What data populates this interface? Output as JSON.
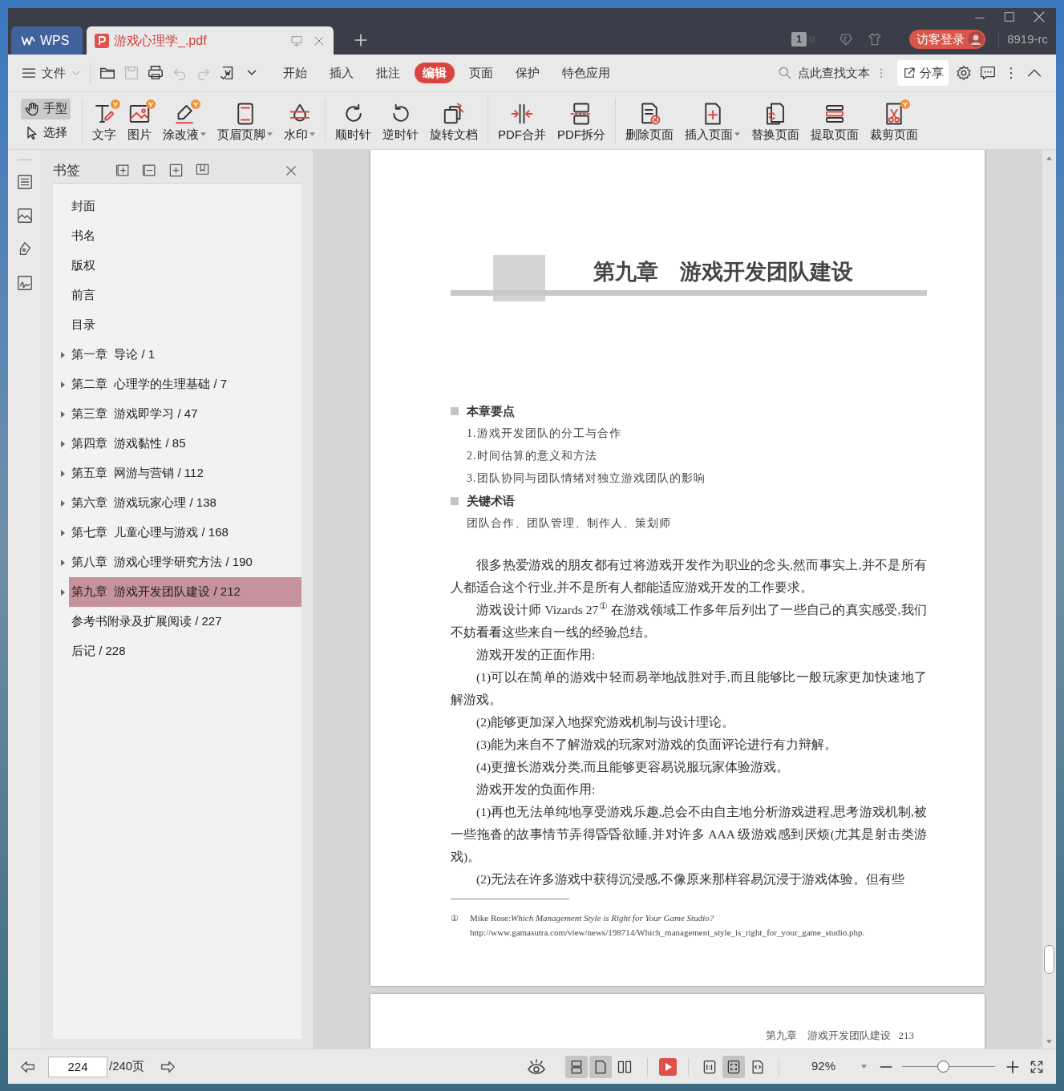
{
  "tabs": [
    {
      "kind": "home",
      "label": "WPS",
      "selected": false
    },
    {
      "kind": "file",
      "label": "游戏心理学_.pdf",
      "selected": true
    }
  ],
  "title_bar": {
    "window_count": "1",
    "login_button": "访客登录",
    "account": "8919-rc"
  },
  "menu_bar": {
    "file_menu": "文件",
    "tabs": [
      {
        "label": "开始",
        "selected": false
      },
      {
        "label": "插入",
        "selected": false
      },
      {
        "label": "批注",
        "selected": false
      },
      {
        "label": "编辑",
        "selected": true
      },
      {
        "label": "页面",
        "selected": false
      },
      {
        "label": "保护",
        "selected": false
      },
      {
        "label": "特色应用",
        "selected": false
      }
    ],
    "search": {
      "placeholder": "点此查找文本"
    },
    "share_button": "分享"
  },
  "toolbar": {
    "modes": [
      {
        "label": "手型",
        "kind": "hand",
        "selected": true
      },
      {
        "label": "选择",
        "kind": "pointer",
        "selected": false
      }
    ],
    "groups": [
      [
        {
          "label": "文字",
          "kind": "text",
          "badge": true,
          "dropdown": false
        },
        {
          "label": "图片",
          "kind": "image",
          "badge": true,
          "dropdown": false
        },
        {
          "label": "涂改液",
          "kind": "pen",
          "badge": true,
          "dropdown": true
        },
        {
          "label": "页眉页脚",
          "kind": "header",
          "badge": false,
          "dropdown": true
        },
        {
          "label": "水印",
          "kind": "watermark",
          "badge": false,
          "dropdown": true
        }
      ],
      [
        {
          "label": "顺时针",
          "kind": "rotate-cw",
          "badge": false,
          "dropdown": false
        },
        {
          "label": "逆时针",
          "kind": "rotate-ccw",
          "badge": false,
          "dropdown": false
        },
        {
          "label": "旋转文档",
          "kind": "rotate-doc",
          "badge": false,
          "dropdown": false
        }
      ],
      [
        {
          "label": "PDF合并",
          "kind": "merge",
          "badge": false,
          "dropdown": false
        },
        {
          "label": "PDF拆分",
          "kind": "split",
          "badge": false,
          "dropdown": false
        }
      ],
      [
        {
          "label": "删除页面",
          "kind": "delete-page",
          "badge": false,
          "dropdown": false
        },
        {
          "label": "插入页面",
          "kind": "insert-page",
          "badge": false,
          "dropdown": true
        },
        {
          "label": "替换页面",
          "kind": "replace-page",
          "badge": false,
          "dropdown": false
        },
        {
          "label": "提取页面",
          "kind": "extract-page",
          "badge": false,
          "dropdown": false
        },
        {
          "label": "裁剪页面",
          "kind": "crop-page",
          "badge": true,
          "dropdown": false
        }
      ]
    ]
  },
  "sidebar": {
    "title": "书签",
    "bookmarks": [
      {
        "label": "封面",
        "expandable": false,
        "selected": false
      },
      {
        "label": "书名",
        "expandable": false,
        "selected": false
      },
      {
        "label": "版权",
        "expandable": false,
        "selected": false
      },
      {
        "label": "前言",
        "expandable": false,
        "selected": false
      },
      {
        "label": "目录",
        "expandable": false,
        "selected": false
      },
      {
        "label": "第一章  导论 / 1",
        "expandable": true,
        "selected": false
      },
      {
        "label": "第二章  心理学的生理基础 / 7",
        "expandable": true,
        "selected": false
      },
      {
        "label": "第三章  游戏即学习 / 47",
        "expandable": true,
        "selected": false
      },
      {
        "label": "第四章  游戏黏性 / 85",
        "expandable": true,
        "selected": false
      },
      {
        "label": "第五章  网游与营销 / 112",
        "expandable": true,
        "selected": false
      },
      {
        "label": "第六章  游戏玩家心理 / 138",
        "expandable": true,
        "selected": false
      },
      {
        "label": "第七章  儿童心理与游戏 / 168",
        "expandable": true,
        "selected": false
      },
      {
        "label": "第八章  游戏心理学研究方法 / 190",
        "expandable": true,
        "selected": false
      },
      {
        "label": "第九章  游戏开发团队建设 / 212",
        "expandable": true,
        "selected": true
      },
      {
        "label": "参考书附录及扩展阅读 / 227",
        "expandable": false,
        "selected": false
      },
      {
        "label": "后记 / 228",
        "expandable": false,
        "selected": false
      }
    ]
  },
  "page": {
    "chapter_title": "第九章　游戏开发团队建设",
    "sections": [
      {
        "heading": "本章要点",
        "lines": [
          "1.游戏开发团队的分工与合作",
          "2.时间估算的意义和方法",
          "3.团队协同与团队情绪对独立游戏团队的影响"
        ]
      },
      {
        "heading": "关键术语",
        "lines": [
          "团队合作、团队管理、制作人、策划师"
        ]
      }
    ],
    "paragraphs": [
      "很多热爱游戏的朋友都有过将游戏开发作为职业的念头,然而事实上,并不是所有人都适合这个行业,并不是所有人都能适应游戏开发的工作要求。",
      "游戏设计师 Vizards 27$^{①}$ 在游戏领域工作多年后列出了一些自己的真实感受,我们不妨看看这些来自一线的经验总结。",
      "游戏开发的正面作用:",
      "(1)可以在简单的游戏中轻而易举地战胜对手,而且能够比一般玩家更加快速地了解游戏。",
      "(2)能够更加深入地探究游戏机制与设计理论。",
      "(3)能为来自不了解游戏的玩家对游戏的负面评论进行有力辩解。",
      "(4)更擅长游戏分类,而且能够更容易说服玩家体验游戏。",
      "游戏开发的负面作用:",
      "(1)再也无法单纯地享受游戏乐趣,总会不由自主地分析游戏进程,思考游戏机制,被一些拖沓的故事情节弄得昏昏欲睡,并对许多 AAA 级游戏感到厌烦(尤其是射击类游戏)。",
      "(2)无法在许多游戏中获得沉浸感,不像原来那样容易沉浸于游戏体验。但有些"
    ],
    "footnote": {
      "mark": "①",
      "text": "Mike Rose:*Which Management Style is Right for Your Game Studio?* http://www.gamasutra.com/view/news/198714/Which_management_style_is_right_for_your_game_studio.php."
    }
  },
  "next_page": {
    "running_head": "第九章　游戏开发团队建设",
    "page_number": "213"
  },
  "status_bar": {
    "page_input": "224",
    "page_total": "/240页",
    "view_buttons": [
      {
        "kind": "continuous",
        "selected": true
      },
      {
        "kind": "single",
        "selected": true
      },
      {
        "kind": "two-page",
        "selected": false
      }
    ],
    "fit_buttons": [
      {
        "kind": "actual-size",
        "selected": false
      },
      {
        "kind": "fit-page",
        "selected": true
      },
      {
        "kind": "fit-width",
        "selected": false
      }
    ],
    "zoom": "92%",
    "zoom_slider": {
      "level": 0.44
    }
  }
}
